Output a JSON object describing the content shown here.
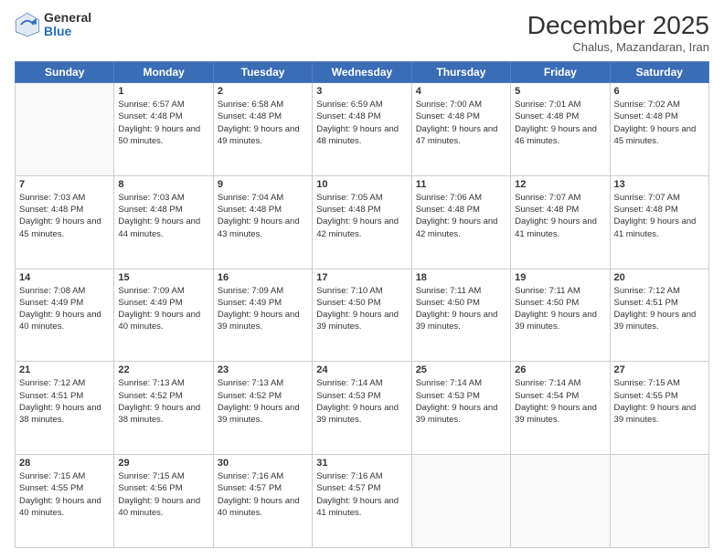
{
  "logo": {
    "general": "General",
    "blue": "Blue"
  },
  "header": {
    "title": "December 2025",
    "subtitle": "Chalus, Mazandaran, Iran"
  },
  "days": [
    "Sunday",
    "Monday",
    "Tuesday",
    "Wednesday",
    "Thursday",
    "Friday",
    "Saturday"
  ],
  "weeks": [
    [
      {
        "day": null,
        "data": null
      },
      {
        "day": 1,
        "sunrise": "6:57 AM",
        "sunset": "4:48 PM",
        "daylight": "9 hours and 50 minutes."
      },
      {
        "day": 2,
        "sunrise": "6:58 AM",
        "sunset": "4:48 PM",
        "daylight": "9 hours and 49 minutes."
      },
      {
        "day": 3,
        "sunrise": "6:59 AM",
        "sunset": "4:48 PM",
        "daylight": "9 hours and 48 minutes."
      },
      {
        "day": 4,
        "sunrise": "7:00 AM",
        "sunset": "4:48 PM",
        "daylight": "9 hours and 47 minutes."
      },
      {
        "day": 5,
        "sunrise": "7:01 AM",
        "sunset": "4:48 PM",
        "daylight": "9 hours and 46 minutes."
      },
      {
        "day": 6,
        "sunrise": "7:02 AM",
        "sunset": "4:48 PM",
        "daylight": "9 hours and 45 minutes."
      }
    ],
    [
      {
        "day": 7,
        "sunrise": "7:03 AM",
        "sunset": "4:48 PM",
        "daylight": "9 hours and 45 minutes."
      },
      {
        "day": 8,
        "sunrise": "7:03 AM",
        "sunset": "4:48 PM",
        "daylight": "9 hours and 44 minutes."
      },
      {
        "day": 9,
        "sunrise": "7:04 AM",
        "sunset": "4:48 PM",
        "daylight": "9 hours and 43 minutes."
      },
      {
        "day": 10,
        "sunrise": "7:05 AM",
        "sunset": "4:48 PM",
        "daylight": "9 hours and 42 minutes."
      },
      {
        "day": 11,
        "sunrise": "7:06 AM",
        "sunset": "4:48 PM",
        "daylight": "9 hours and 42 minutes."
      },
      {
        "day": 12,
        "sunrise": "7:07 AM",
        "sunset": "4:48 PM",
        "daylight": "9 hours and 41 minutes."
      },
      {
        "day": 13,
        "sunrise": "7:07 AM",
        "sunset": "4:48 PM",
        "daylight": "9 hours and 41 minutes."
      }
    ],
    [
      {
        "day": 14,
        "sunrise": "7:08 AM",
        "sunset": "4:49 PM",
        "daylight": "9 hours and 40 minutes."
      },
      {
        "day": 15,
        "sunrise": "7:09 AM",
        "sunset": "4:49 PM",
        "daylight": "9 hours and 40 minutes."
      },
      {
        "day": 16,
        "sunrise": "7:09 AM",
        "sunset": "4:49 PM",
        "daylight": "9 hours and 39 minutes."
      },
      {
        "day": 17,
        "sunrise": "7:10 AM",
        "sunset": "4:50 PM",
        "daylight": "9 hours and 39 minutes."
      },
      {
        "day": 18,
        "sunrise": "7:11 AM",
        "sunset": "4:50 PM",
        "daylight": "9 hours and 39 minutes."
      },
      {
        "day": 19,
        "sunrise": "7:11 AM",
        "sunset": "4:50 PM",
        "daylight": "9 hours and 39 minutes."
      },
      {
        "day": 20,
        "sunrise": "7:12 AM",
        "sunset": "4:51 PM",
        "daylight": "9 hours and 39 minutes."
      }
    ],
    [
      {
        "day": 21,
        "sunrise": "7:12 AM",
        "sunset": "4:51 PM",
        "daylight": "9 hours and 38 minutes."
      },
      {
        "day": 22,
        "sunrise": "7:13 AM",
        "sunset": "4:52 PM",
        "daylight": "9 hours and 38 minutes."
      },
      {
        "day": 23,
        "sunrise": "7:13 AM",
        "sunset": "4:52 PM",
        "daylight": "9 hours and 39 minutes."
      },
      {
        "day": 24,
        "sunrise": "7:14 AM",
        "sunset": "4:53 PM",
        "daylight": "9 hours and 39 minutes."
      },
      {
        "day": 25,
        "sunrise": "7:14 AM",
        "sunset": "4:53 PM",
        "daylight": "9 hours and 39 minutes."
      },
      {
        "day": 26,
        "sunrise": "7:14 AM",
        "sunset": "4:54 PM",
        "daylight": "9 hours and 39 minutes."
      },
      {
        "day": 27,
        "sunrise": "7:15 AM",
        "sunset": "4:55 PM",
        "daylight": "9 hours and 39 minutes."
      }
    ],
    [
      {
        "day": 28,
        "sunrise": "7:15 AM",
        "sunset": "4:55 PM",
        "daylight": "9 hours and 40 minutes."
      },
      {
        "day": 29,
        "sunrise": "7:15 AM",
        "sunset": "4:56 PM",
        "daylight": "9 hours and 40 minutes."
      },
      {
        "day": 30,
        "sunrise": "7:16 AM",
        "sunset": "4:57 PM",
        "daylight": "9 hours and 40 minutes."
      },
      {
        "day": 31,
        "sunrise": "7:16 AM",
        "sunset": "4:57 PM",
        "daylight": "9 hours and 41 minutes."
      },
      {
        "day": null,
        "data": null
      },
      {
        "day": null,
        "data": null
      },
      {
        "day": null,
        "data": null
      }
    ]
  ],
  "labels": {
    "sunrise": "Sunrise:",
    "sunset": "Sunset:",
    "daylight": "Daylight:"
  }
}
